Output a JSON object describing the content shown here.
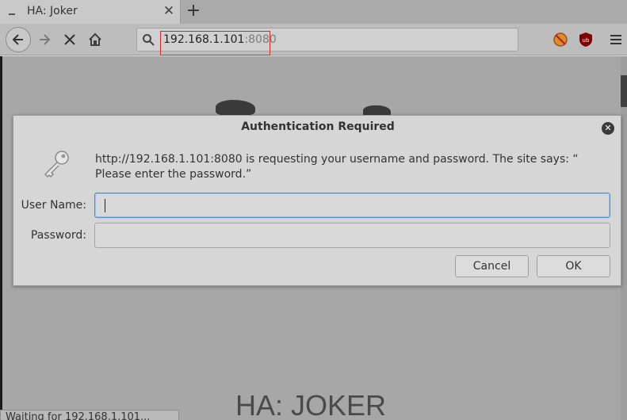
{
  "tab": {
    "title": "HA: Joker",
    "close_glyph": "✕",
    "new_tab_glyph": "+"
  },
  "urlbar": {
    "host": "192.168.1.101",
    "port": ":8080"
  },
  "page": {
    "heading": "HA: JOKER",
    "status": "Waiting for 192.168.1.101..."
  },
  "dialog": {
    "title": "Authentication Required",
    "message": "http://192.168.1.101:8080 is requesting your username and password. The site says: “ Please enter the password.”",
    "username_label": "User Name:",
    "password_label": "Password:",
    "username_value": "",
    "password_value": "",
    "cancel_label": "Cancel",
    "ok_label": "OK",
    "close_glyph": "✕"
  },
  "icons": [
    "tab-media-icon",
    "back-arrow-icon",
    "forward-arrow-icon",
    "stop-icon",
    "home-icon",
    "search-icon",
    "no-script-extension-icon",
    "ublock-origin-icon",
    "hamburger-menu-icon",
    "key-icon",
    "close-icon"
  ],
  "colors": {
    "focus_ring": "#4a90d9",
    "url_highlight_box": "#d32a2a"
  }
}
